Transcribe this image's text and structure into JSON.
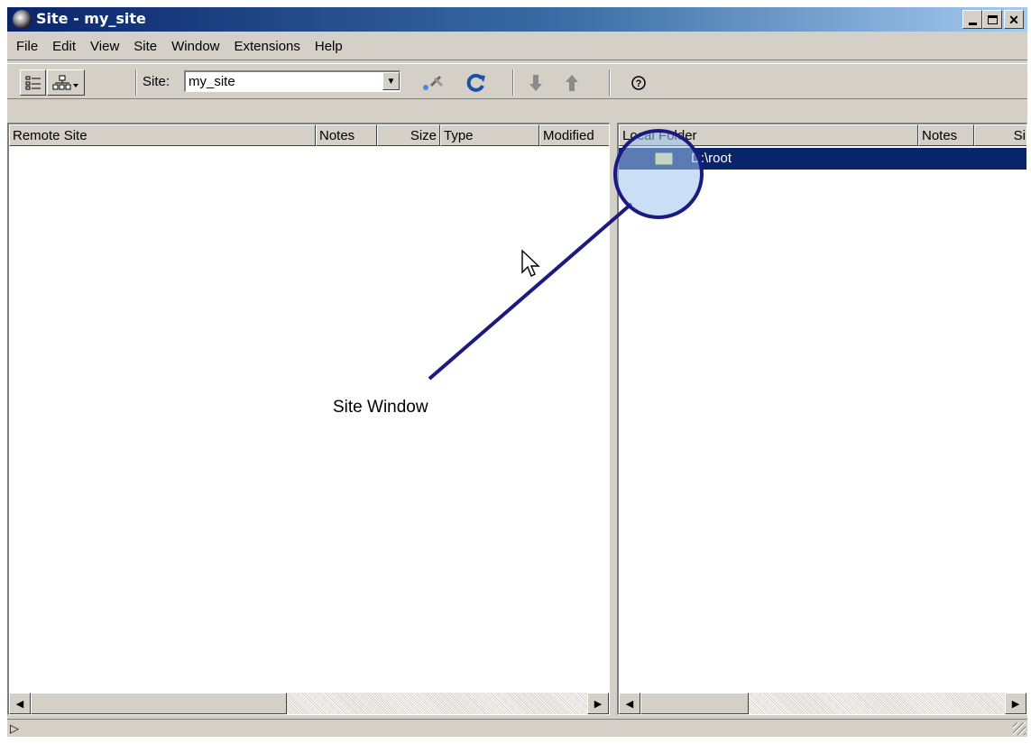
{
  "window": {
    "title": "Site - my_site"
  },
  "menu": {
    "items": [
      "File",
      "Edit",
      "View",
      "Site",
      "Window",
      "Extensions",
      "Help"
    ]
  },
  "toolbar": {
    "site_label": "Site:",
    "site_value": "my_site",
    "icons": [
      "file-view-icon",
      "site-map-icon",
      "connect-icon",
      "refresh-icon",
      "get-icon",
      "put-icon",
      "help-icon"
    ]
  },
  "remote_pane": {
    "columns": [
      "Remote Site",
      "Notes",
      "Size",
      "Type",
      "Modified"
    ]
  },
  "local_pane": {
    "columns": [
      "Local Folder",
      "Notes",
      "Si"
    ],
    "rows": [
      {
        "label": "D:\\root",
        "selected": true
      }
    ]
  },
  "callout": {
    "label": "Site Window"
  },
  "colors": {
    "selection": "#0a246a",
    "callout": "#1a1a80",
    "chrome": "#d4d0c8"
  }
}
